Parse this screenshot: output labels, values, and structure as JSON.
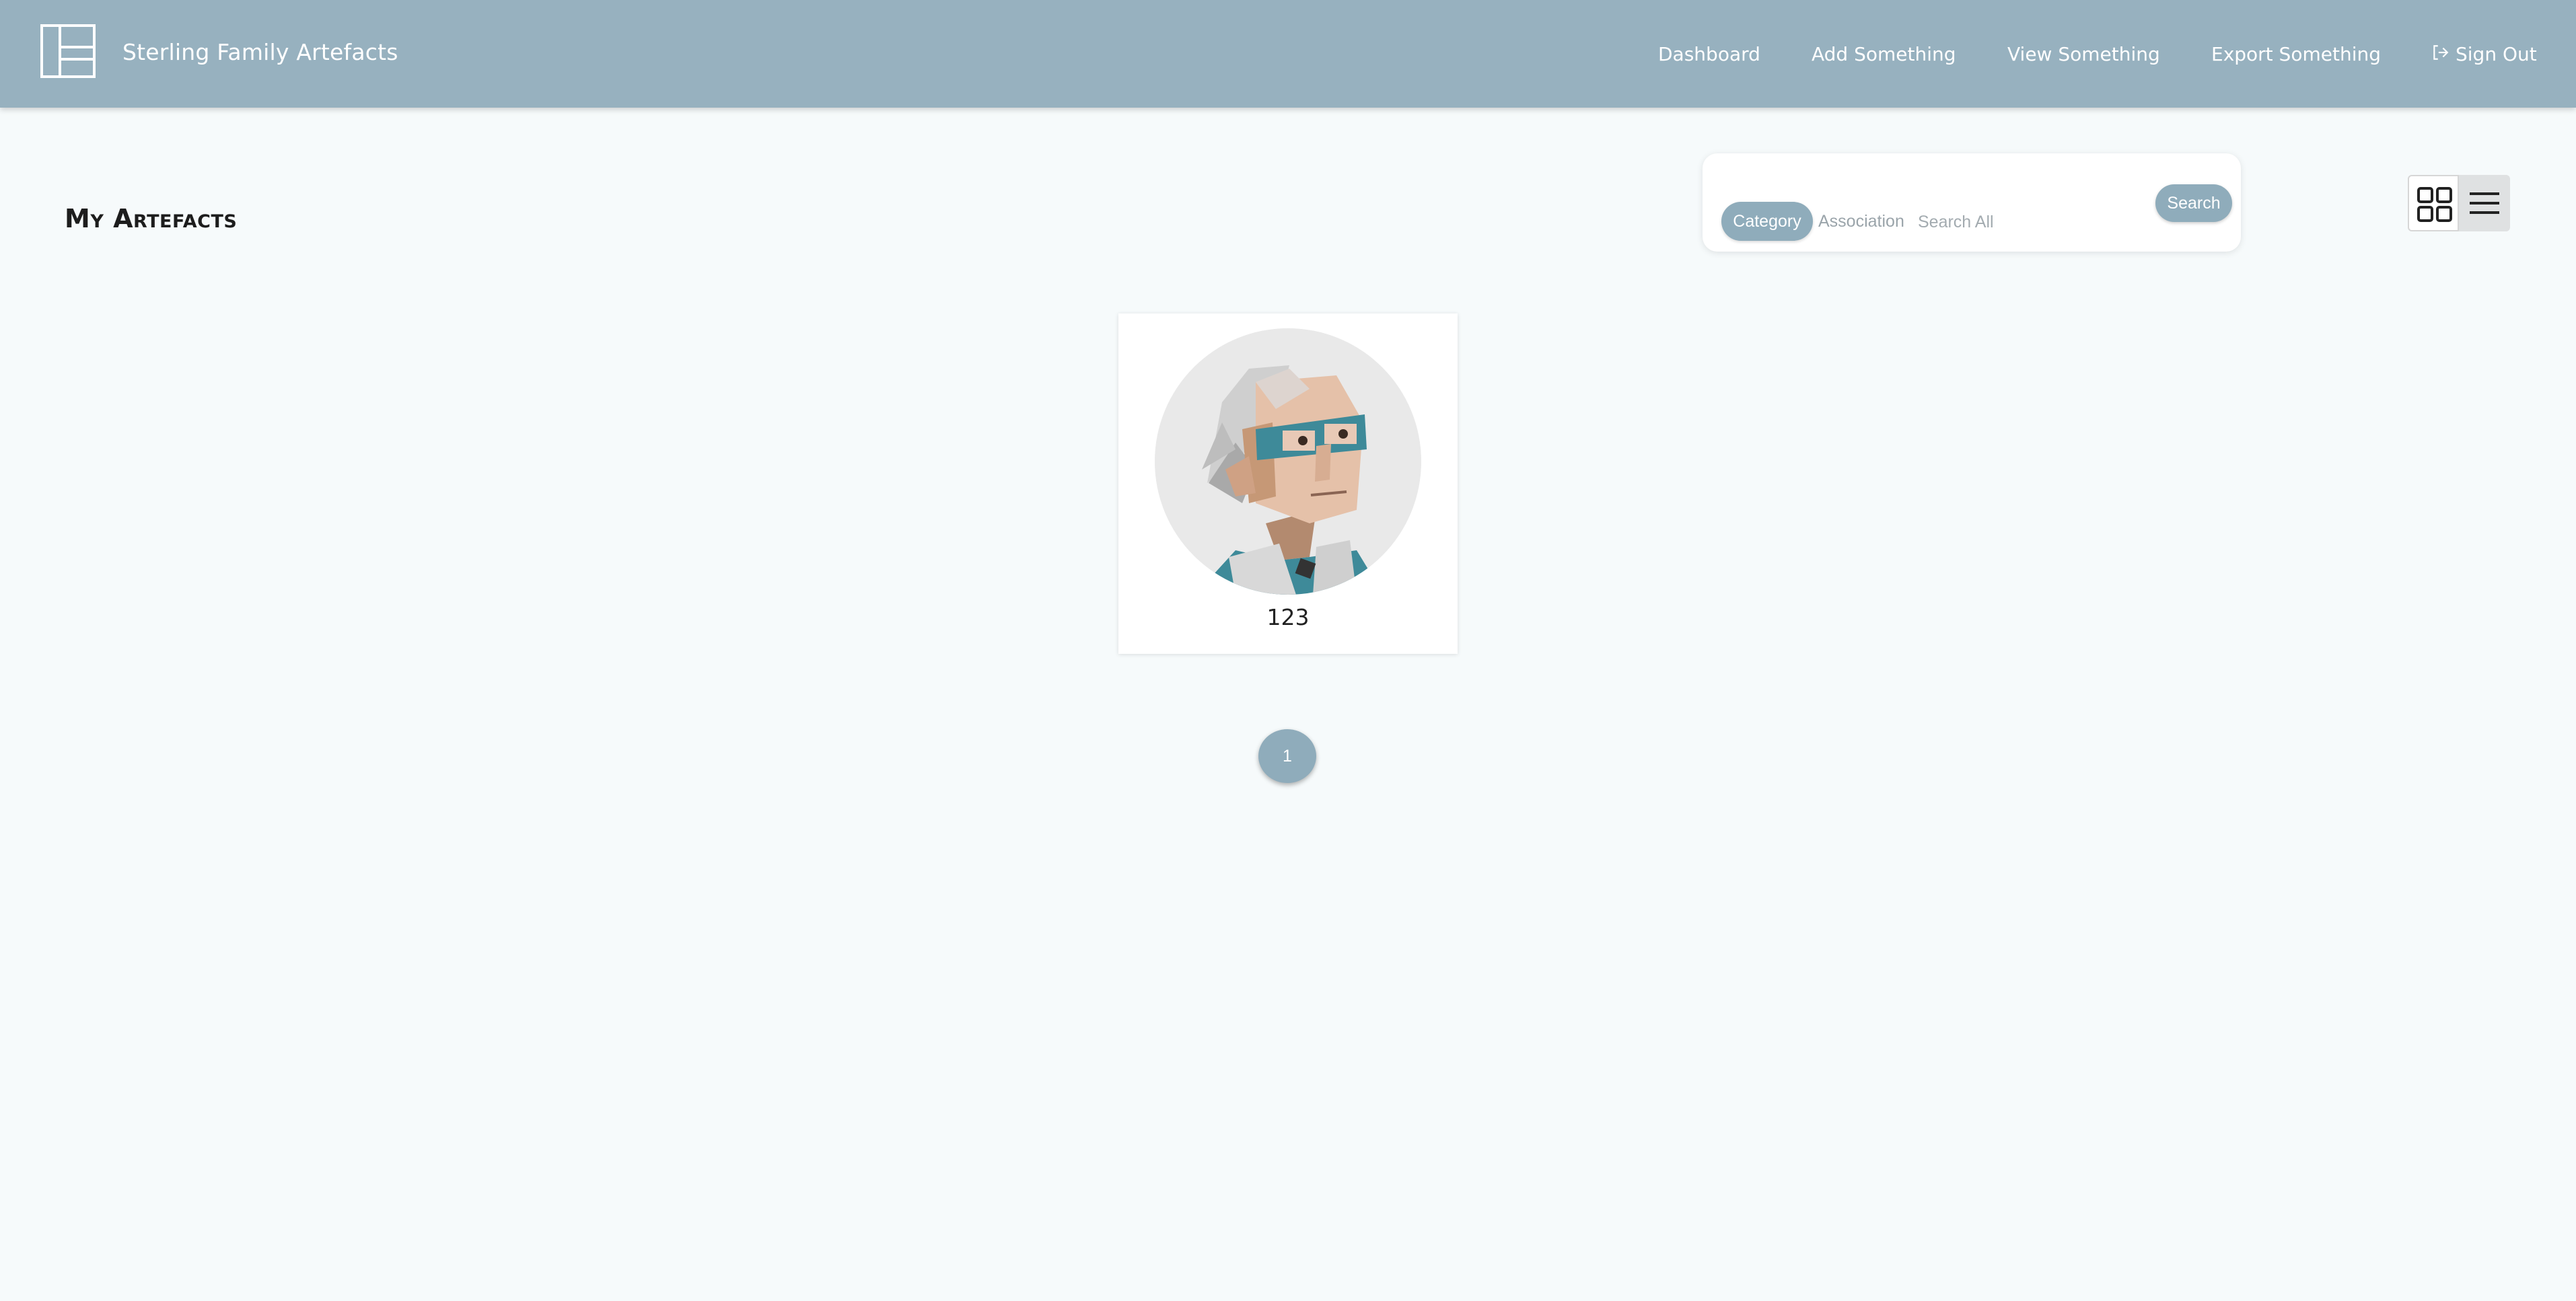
{
  "app": {
    "title": "Sterling Family Artefacts"
  },
  "nav": {
    "items": [
      {
        "label": "Dashboard"
      },
      {
        "label": "Add Something"
      },
      {
        "label": "View Something"
      },
      {
        "label": "Export Something"
      },
      {
        "label": "Sign Out",
        "icon": "sign-out-icon"
      }
    ]
  },
  "main": {
    "title": "My Artefacts"
  },
  "search": {
    "tabs": [
      {
        "label": "Category",
        "active": true
      },
      {
        "label": "Association",
        "active": false
      }
    ],
    "placeholder": "Search All",
    "value": "",
    "button_label": "Search"
  },
  "view_toggle": {
    "options": [
      {
        "icon": "grid-view-icon",
        "active": true
      },
      {
        "icon": "list-view-icon",
        "active": false
      }
    ]
  },
  "artefacts": [
    {
      "label": "123",
      "image": "person-avatar-illustration"
    }
  ],
  "pagination": {
    "pages": [
      "1"
    ],
    "current": "1"
  },
  "colors": {
    "header": "#97b1bf",
    "accent": "#8facbb",
    "background": "#f6fafb"
  }
}
